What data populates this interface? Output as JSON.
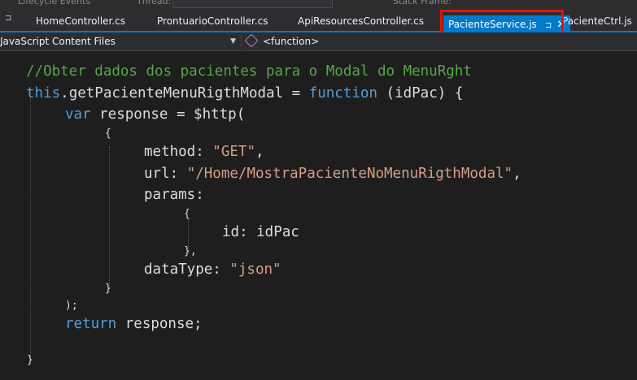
{
  "toolbar": {
    "lifecycle_label": "Lifecycle Events",
    "thread_label": "Thread:",
    "stackframe_label": "Stack Frame:"
  },
  "tabs": [
    {
      "label": "HomeController.cs",
      "active": false
    },
    {
      "label": "ProntuarioController.cs",
      "active": false
    },
    {
      "label": "ApiResourcesController.cs",
      "active": false
    },
    {
      "label": "PacienteService.js",
      "active": true,
      "pin_icon": "pin-icon",
      "close_icon": "close-icon"
    },
    {
      "label": "PacienteCtrl.js",
      "active": false
    }
  ],
  "navbar": {
    "project_selector": "JavaScript Content Files",
    "member_selector": "<function>"
  },
  "code": {
    "l1": "//Obter dados dos pacientes para o Modal do MenuRght",
    "l2_this": "this",
    "l2_name": ".getPacienteMenuRigthModal = ",
    "l2_kw": "function",
    "l2_rest": " (idPac) {",
    "l3_kw": "var",
    "l3_rest": " response = $http(",
    "l4": "{",
    "l5_key": "method: ",
    "l5_val": "\"GET\"",
    "l5_end": ",",
    "l6_key": "url: ",
    "l6_val": "\"/Home/MostraPacienteNoMenuRigthModal\"",
    "l6_end": ",",
    "l7": "params:",
    "l8": "{",
    "l9": "id: idPac",
    "l10": "},",
    "l11_key": "dataType: ",
    "l11_val": "\"json\"",
    "l12": "}",
    "l13": ");",
    "l14_kw": "return",
    "l14_rest": " response;",
    "l16": "}"
  },
  "colors": {
    "tab_active": "#007acc",
    "highlight_box": "#e51400",
    "comment": "#57a64a",
    "keyword": "#569cd6",
    "string": "#d69d85"
  }
}
